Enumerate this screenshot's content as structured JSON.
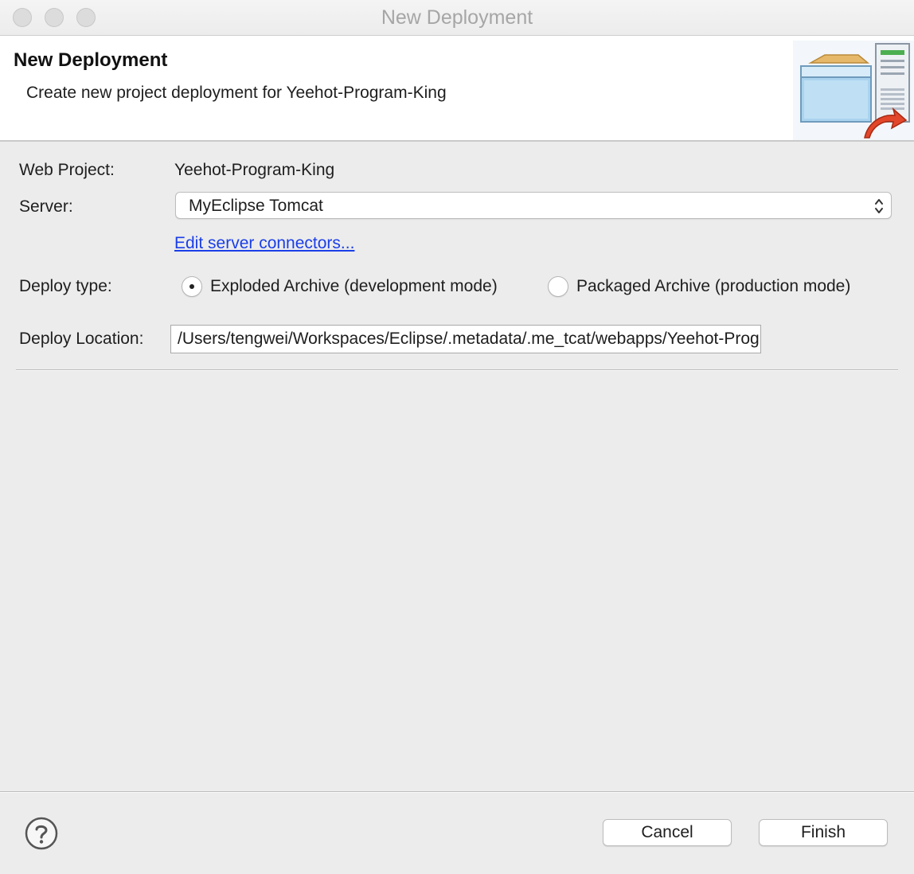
{
  "window": {
    "title": "New Deployment"
  },
  "banner": {
    "title": "New Deployment",
    "description": "Create new project deployment for Yeehot-Program-King",
    "icon": "deployment-server-icon"
  },
  "form": {
    "web_project_label": "Web Project:",
    "web_project_value": "Yeehot-Program-King",
    "server_label": "Server:",
    "server_value": "MyEclipse Tomcat",
    "edit_connectors_link": "Edit server connectors...",
    "deploy_type_label": "Deploy type:",
    "deploy_types": [
      {
        "label": "Exploded Archive (development mode)",
        "selected": true
      },
      {
        "label": "Packaged Archive (production mode)",
        "selected": false
      }
    ],
    "deploy_location_label": "Deploy Location:",
    "deploy_location_value": "/Users/tengwei/Workspaces/Eclipse/.metadata/.me_tcat/webapps/Yeehot-Program-King"
  },
  "footer": {
    "help_icon": "help-icon",
    "cancel_label": "Cancel",
    "finish_label": "Finish"
  },
  "colors": {
    "link": "#1a3ee8",
    "window_bg": "#ececec",
    "banner_bg": "#ffffff"
  }
}
